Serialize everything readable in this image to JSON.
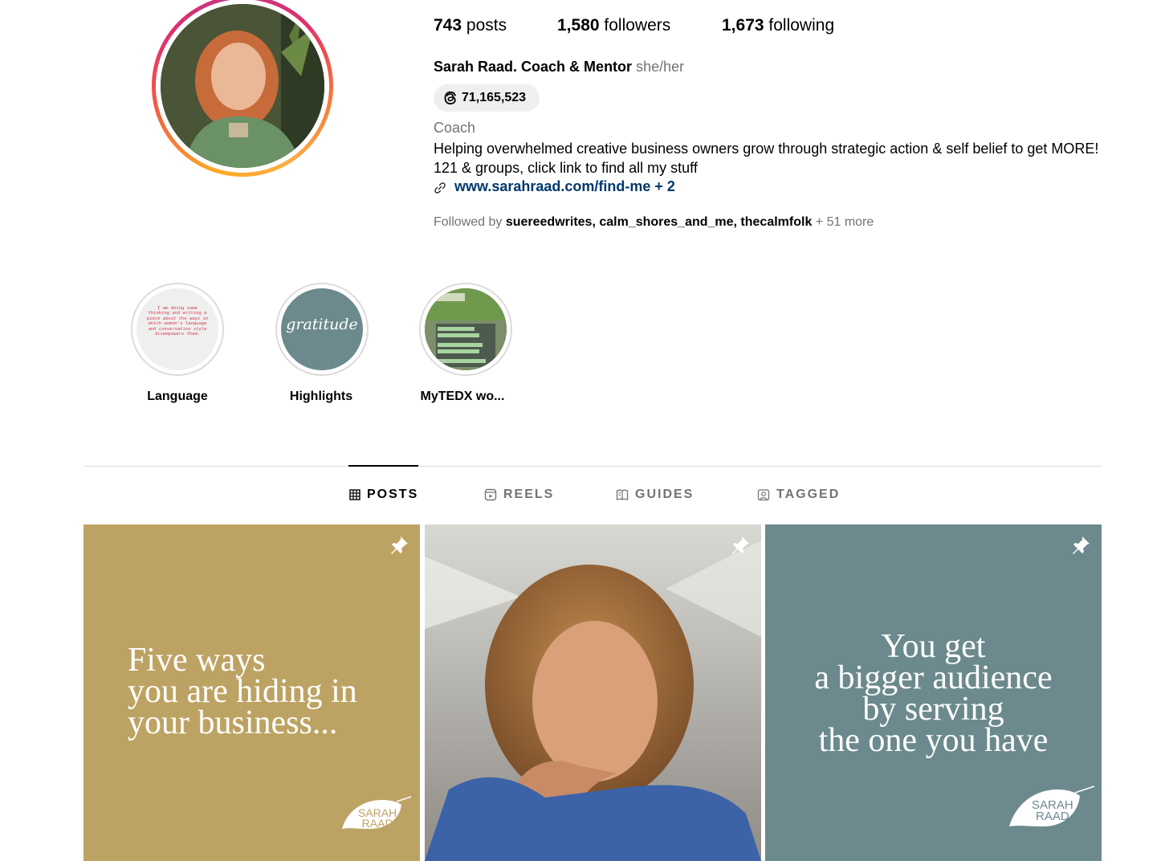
{
  "profile": {
    "stats": {
      "posts_count": "743",
      "posts_label": "posts",
      "followers_count": "1,580",
      "followers_label": "followers",
      "following_count": "1,673",
      "following_label": "following"
    },
    "name": "Sarah Raad. Coach & Mentor",
    "pronouns": "she/her",
    "threads_count": "71,165,523",
    "category": "Coach",
    "bio": "Helping overwhelmed creative business owners grow through strategic action & self belief to get MORE! 121 & groups, click link to find all my stuff",
    "link": "www.sarahraad.com/find-me + 2",
    "followed_by": {
      "prefix": "Followed by ",
      "users": [
        "suereedwrites",
        "calm_shores_and_me",
        "thecalmfolk"
      ],
      "more": " + 51 more"
    }
  },
  "highlights": [
    {
      "label": "Language",
      "cover_text": "I am doing some thinking and writing a piece about the ways in which women's language and conversation style disempowers them."
    },
    {
      "label": "Highlights",
      "cover_text": "gratitude"
    },
    {
      "label": "MyTEDX wo..."
    }
  ],
  "tabs": [
    {
      "label": "POSTS",
      "icon": "grid-icon",
      "active": true
    },
    {
      "label": "REELS",
      "icon": "reels-icon",
      "active": false
    },
    {
      "label": "GUIDES",
      "icon": "guides-icon",
      "active": false
    },
    {
      "label": "TAGGED",
      "icon": "tagged-icon",
      "active": false
    }
  ],
  "posts": [
    {
      "type": "quote",
      "text": "Five ways\nyou are hiding in\nyour business...",
      "background": "#bda363",
      "logo_text": "SARAH\nRAAD",
      "logo_color": "#bda363",
      "pinned": true
    },
    {
      "type": "photo",
      "pinned": true
    },
    {
      "type": "quote",
      "text": "You get\na bigger audience\nby serving\nthe one you have",
      "background": "#6c8a8e",
      "logo_text": "SARAH\nRAAD",
      "logo_color": "#6c8a8e",
      "pinned": true
    }
  ],
  "colors": {
    "link": "#00376b",
    "muted": "#737373",
    "gratitude_bg": "#6c8a8e"
  }
}
